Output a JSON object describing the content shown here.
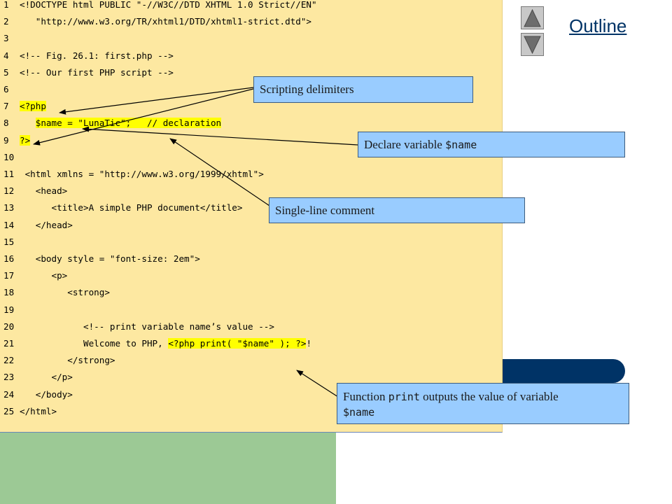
{
  "nav": {
    "outline_label": "Outline",
    "up_icon": "triangle-up-icon",
    "down_icon": "triangle-down-icon"
  },
  "code_lines": [
    {
      "num": "1",
      "parts": [
        {
          "t": "<!DOCTYPE html PUBLIC \"-//W3C//DTD XHTML 1.0 Strict//EN\""
        }
      ]
    },
    {
      "num": "2",
      "parts": [
        {
          "t": "   \"http://www.w3.org/TR/xhtml1/DTD/xhtml1-strict.dtd\">"
        }
      ]
    },
    {
      "num": "3",
      "parts": []
    },
    {
      "num": "4",
      "parts": [
        {
          "t": "<!-- Fig. 26.1: first.php -->"
        }
      ]
    },
    {
      "num": "5",
      "parts": [
        {
          "t": "<!-- Our first PHP script -->"
        }
      ]
    },
    {
      "num": "6",
      "parts": []
    },
    {
      "num": "7",
      "parts": [
        {
          "t": "<?php",
          "hl": true
        }
      ]
    },
    {
      "num": "8",
      "parts": [
        {
          "t": "   "
        },
        {
          "t": "$name = \"LunaTic\";   // declaration",
          "hl": true
        }
      ]
    },
    {
      "num": "9",
      "parts": [
        {
          "t": "?>",
          "hl": true
        }
      ]
    },
    {
      "num": "10",
      "parts": []
    },
    {
      "num": "11",
      "parts": [
        {
          "t": " <html xmlns = \"http://www.w3.org/1999/xhtml\">"
        }
      ]
    },
    {
      "num": "12",
      "parts": [
        {
          "t": "   <head>"
        }
      ]
    },
    {
      "num": "13",
      "parts": [
        {
          "t": "      <title>A simple PHP document</title>"
        }
      ]
    },
    {
      "num": "14",
      "parts": [
        {
          "t": "   </head>"
        }
      ]
    },
    {
      "num": "15",
      "parts": []
    },
    {
      "num": "16",
      "parts": [
        {
          "t": "   <body style = \"font-size: 2em\">"
        }
      ]
    },
    {
      "num": "17",
      "parts": [
        {
          "t": "      <p>"
        }
      ]
    },
    {
      "num": "18",
      "parts": [
        {
          "t": "         <strong>"
        }
      ]
    },
    {
      "num": "19",
      "parts": []
    },
    {
      "num": "20",
      "parts": [
        {
          "t": "            <!-- print variable name’s value -->"
        }
      ]
    },
    {
      "num": "21",
      "parts": [
        {
          "t": "            Welcome to PHP, "
        },
        {
          "t": "<?php print( \"$name\" ); ?>",
          "hl": true
        },
        {
          "t": "!"
        }
      ]
    },
    {
      "num": "22",
      "parts": [
        {
          "t": "         </strong>"
        }
      ]
    },
    {
      "num": "23",
      "parts": [
        {
          "t": "      </p>"
        }
      ]
    },
    {
      "num": "24",
      "parts": [
        {
          "t": "   </body>"
        }
      ]
    },
    {
      "num": "25",
      "parts": [
        {
          "t": "</html>"
        }
      ]
    }
  ],
  "callouts": {
    "delimiters": "Scripting delimiters",
    "declare_prefix": "Declare variable ",
    "declare_code": "$name",
    "comment": "Single-line comment",
    "print_prefix": "Function ",
    "print_code": "print",
    "print_mid": " outputs the value of variable",
    "print_var": "$name"
  },
  "colors": {
    "code_background": "#fde8a1",
    "highlight": "#ffff00",
    "callout_background": "#99ccff",
    "accent_bar": "#003366",
    "side_panel": "#9cc995",
    "outline_link": "#003366"
  }
}
